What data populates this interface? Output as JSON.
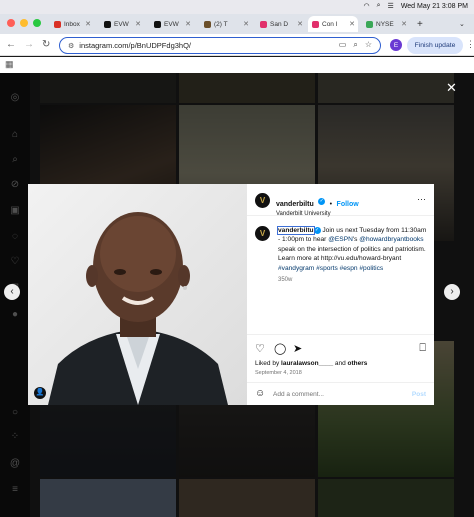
{
  "menubar": {
    "datetime": "Wed May 21 3:08 PM"
  },
  "tabs": [
    {
      "label": "Inbox",
      "color": "#d93025"
    },
    {
      "label": "EVW",
      "color": "#111111"
    },
    {
      "label": "EVW",
      "color": "#111111"
    },
    {
      "label": "(2) T",
      "color": "#6b4f2a"
    },
    {
      "label": "San D",
      "color": "#e1306c"
    },
    {
      "label": "Con I",
      "color": "#e1306c"
    },
    {
      "label": "NYSE",
      "color": "#3aa757"
    }
  ],
  "toolbar": {
    "url": "instagram.com/p/BnUDPFdg3hQ/",
    "profile_initial": "E",
    "finish_update": "Finish update"
  },
  "post": {
    "username": "vanderbiltu",
    "follow": "Follow",
    "location": "Vanderbilt University",
    "more": "···",
    "caption_user": "vanderbiltu",
    "caption_pre": " Join us next Tuesday from 11:30am - 1:00pm to hear ",
    "caption_mention1": "@ESPN",
    "caption_mid": "'s ",
    "caption_mention2": "@howardbryantbooks",
    "caption_post": " speak on the intersection of politics and patriotism. Learn more at http://vu.edu/howard-bryant ",
    "caption_tags": "#vandygram #sports #espn #politics",
    "ago": "350w",
    "liked_by_prefix": "Liked by ",
    "liked_by_user": "lauralawson____",
    "liked_by_and": " and ",
    "liked_by_others": "others",
    "date": "September 4, 2018",
    "comment_placeholder": "Add a comment...",
    "post_label": "Post"
  },
  "colors": {
    "accent": "#0095f6",
    "brand_gold": "#c9a94a"
  }
}
